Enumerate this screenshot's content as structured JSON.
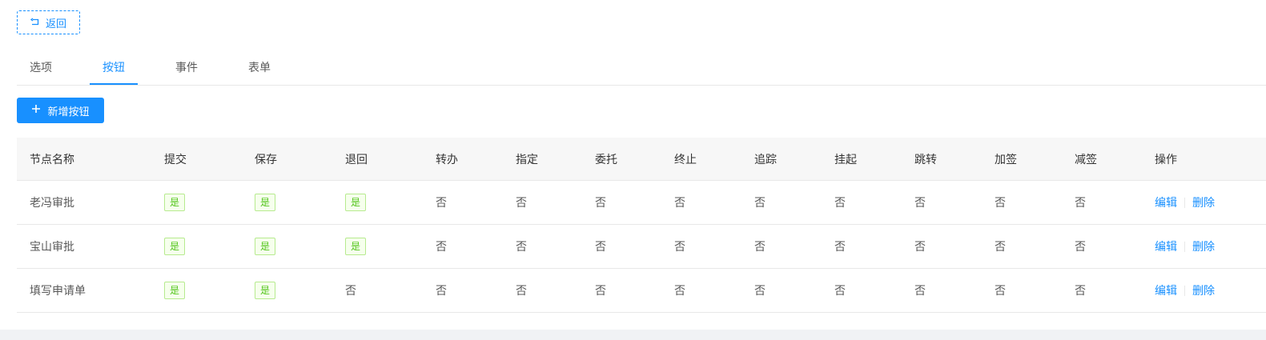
{
  "back_button": {
    "label": "返回",
    "icon": "undo-arrow-icon"
  },
  "tabs": [
    {
      "label": "选项",
      "active": false
    },
    {
      "label": "按钮",
      "active": true
    },
    {
      "label": "事件",
      "active": false
    },
    {
      "label": "表单",
      "active": false
    }
  ],
  "add_button": {
    "label": "新增按钮",
    "icon": "plus-icon"
  },
  "table": {
    "headers": [
      "节点名称",
      "提交",
      "保存",
      "退回",
      "转办",
      "指定",
      "委托",
      "终止",
      "追踪",
      "挂起",
      "跳转",
      "加签",
      "减签",
      "操作"
    ],
    "rows": [
      {
        "name": "老冯审批",
        "flags": [
          "是",
          "是",
          "是",
          "否",
          "否",
          "否",
          "否",
          "否",
          "否",
          "否",
          "否",
          "否"
        ],
        "actions": [
          "编辑",
          "删除"
        ]
      },
      {
        "name": "宝山审批",
        "flags": [
          "是",
          "是",
          "是",
          "否",
          "否",
          "否",
          "否",
          "否",
          "否",
          "否",
          "否",
          "否"
        ],
        "actions": [
          "编辑",
          "删除"
        ]
      },
      {
        "name": "填写申请单",
        "flags": [
          "是",
          "是",
          "否",
          "否",
          "否",
          "否",
          "否",
          "否",
          "否",
          "否",
          "否",
          "否"
        ],
        "actions": [
          "编辑",
          "删除"
        ]
      }
    ]
  },
  "colors": {
    "primary": "#1890ff",
    "success": "#52c41a"
  }
}
